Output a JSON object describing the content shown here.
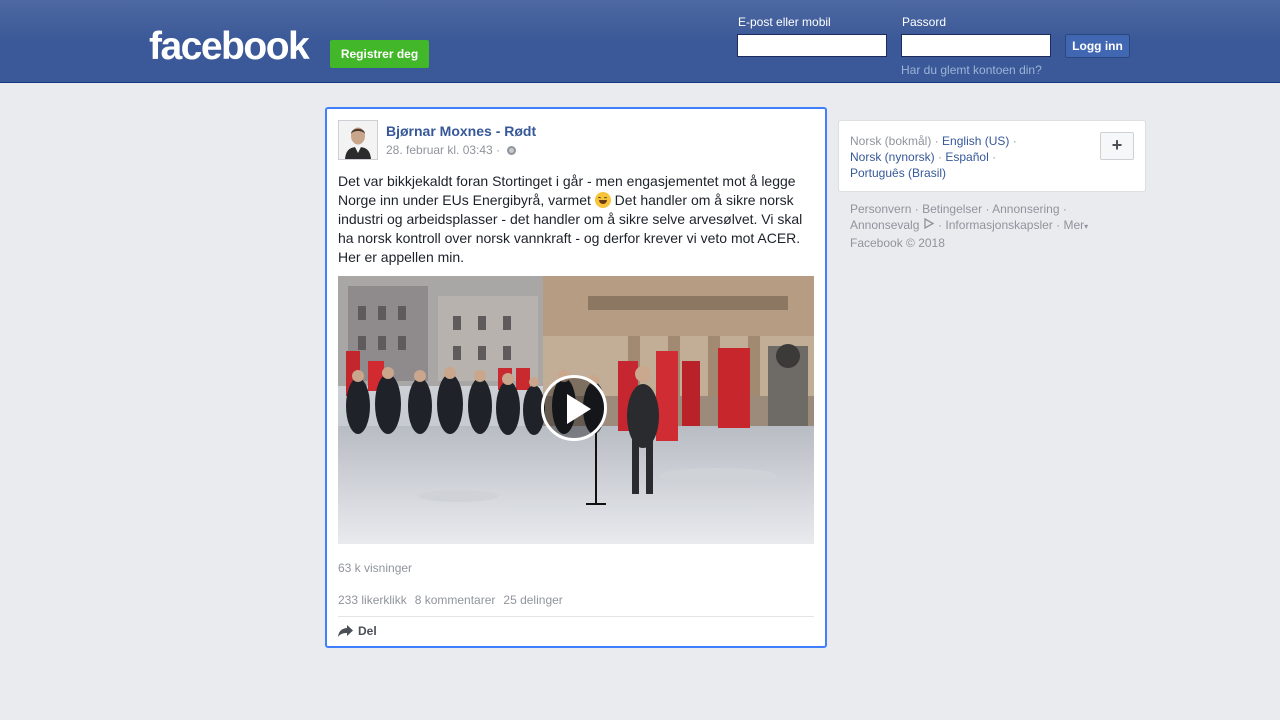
{
  "header": {
    "logo": "facebook",
    "register_label": "Registrer deg",
    "email_label": "E-post eller mobil",
    "password_label": "Passord",
    "login_label": "Logg inn",
    "forgot_label": "Har du glemt kontoen din?",
    "email_value": "",
    "password_value": ""
  },
  "post": {
    "author": "Bjørnar Moxnes - Rødt",
    "timestamp": "28. februar kl. 03:43 ·",
    "text_part1": "Det var bikkjekaldt foran Stortinget i går - men engasjementet mot å legge Norge inn under EUs Energibyrå, varmet",
    "text_part2": " Det handler om å sikre norsk industri og arbeidsplasser - det handler om å sikre selve arvesølvet. Vi skal ha norsk kontroll over norsk vannkraft - og derfor krever vi veto mot ACER. Her er appellen min.",
    "views": "63 k visninger",
    "likes": "233 likerklikk",
    "comments": "8 kommentarer",
    "shares": "25 delinger",
    "share_label": "Del"
  },
  "languages": {
    "current": "Norsk (bokmål)",
    "sep": "·",
    "options": [
      "English (US)",
      "Norsk (nynorsk)",
      "Español",
      "Português (Brasil)"
    ],
    "add_label": "+"
  },
  "footer": {
    "links": [
      "Personvern",
      "Betingelser",
      "Annonsering",
      "Annonsevalg",
      "Informasjonskapsler",
      "Mer"
    ],
    "copyright": "Facebook © 2018"
  },
  "colors": {
    "topbar": "#3b5998",
    "register": "#42b72a",
    "link": "#365899",
    "post_border": "#4080ff"
  }
}
